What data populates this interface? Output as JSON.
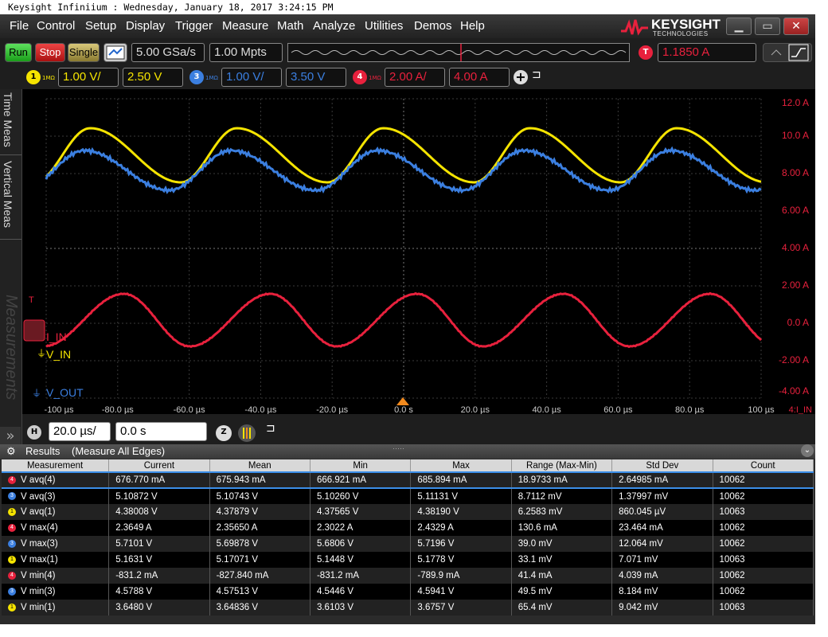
{
  "title_bar": "Keysight Infiniium : Wednesday, January 18, 2017 3:24:15 PM",
  "menu": [
    "File",
    "Control",
    "Setup",
    "Display",
    "Trigger",
    "Measure",
    "Math",
    "Analyze",
    "Utilities",
    "Demos",
    "Help"
  ],
  "logo": {
    "name": "KEYSIGHT",
    "sub": "TECHNOLOGIES"
  },
  "toolbar": {
    "run": "Run",
    "stop": "Stop",
    "single": "Single",
    "sample_rate": "5.00 GSa/s",
    "memory": "1.00 Mpts",
    "trigger_badge": "T",
    "trigger_level": "1.1850 A"
  },
  "channels": [
    {
      "num": "1",
      "imp": "1MΩ",
      "scale": "1.00 V/",
      "offset": "2.50 V",
      "color": "#f5e400"
    },
    {
      "num": "3",
      "imp": "1MΩ",
      "scale": "1.00 V/",
      "offset": "3.50 V",
      "color": "#3b7fe0"
    },
    {
      "num": "4",
      "imp": "1MΩ",
      "scale": "2.00 A/",
      "offset": "4.00 A",
      "color": "#e8213d"
    }
  ],
  "side_tabs": [
    "Time Meas",
    "Vertical Meas",
    "Measurements"
  ],
  "scope": {
    "right_axis": [
      "12.0 A",
      "10.0 A",
      "8.00 A",
      "6.00 A",
      "4.00 A",
      "2.00 A",
      "0.0 A",
      "-2.00 A",
      "-4.00 A"
    ],
    "time_axis": [
      "-100 µs",
      "-80.0 µs",
      "-60.0 µs",
      "-40.0 µs",
      "-20.0 µs",
      "0.0 s",
      "20.0 µs",
      "40.0 µs",
      "60.0 µs",
      "80.0 µs",
      "100 µs"
    ],
    "axis_marker": "4:I_IN",
    "labels": {
      "i_in": "I_IN",
      "v_in": "V_IN",
      "v_out": "V_OUT",
      "trigger": "T"
    }
  },
  "horizontal": {
    "badge": "H",
    "scale": "20.0 µs/",
    "position": "0.0 s"
  },
  "results": {
    "title": "Results",
    "mode": "(Measure All Edges)",
    "columns": [
      "Measurement",
      "Current",
      "Mean",
      "Min",
      "Max",
      "Range (Max-Min)",
      "Std Dev",
      "Count"
    ],
    "rows": [
      {
        "ch": "4",
        "color": "#e8213d",
        "cells": [
          "V avq(4)",
          "676.770 mA",
          "675.943 mA",
          "666.921 mA",
          "685.894 mA",
          "18.9733 mA",
          "2.64985 mA",
          "10062"
        ]
      },
      {
        "ch": "3",
        "color": "#3b7fe0",
        "cells": [
          "V avq(3)",
          "5.10872 V",
          "5.10743 V",
          "5.10260 V",
          "5.11131 V",
          "8.7112 mV",
          "1.37997 mV",
          "10062"
        ]
      },
      {
        "ch": "1",
        "color": "#f5e400",
        "cells": [
          "V avq(1)",
          "4.38008 V",
          "4.37879 V",
          "4.37565 V",
          "4.38190 V",
          "6.2583 mV",
          "860.045 µV",
          "10063"
        ]
      },
      {
        "ch": "4",
        "color": "#e8213d",
        "cells": [
          "V max(4)",
          "2.3649 A",
          "2.35650 A",
          "2.3022 A",
          "2.4329 A",
          "130.6 mA",
          "23.464 mA",
          "10062"
        ]
      },
      {
        "ch": "3",
        "color": "#3b7fe0",
        "cells": [
          "V max(3)",
          "5.7101 V",
          "5.69878 V",
          "5.6806 V",
          "5.7196 V",
          "39.0 mV",
          "12.064 mV",
          "10062"
        ]
      },
      {
        "ch": "1",
        "color": "#f5e400",
        "cells": [
          "V max(1)",
          "5.1631 V",
          "5.17071 V",
          "5.1448 V",
          "5.1778 V",
          "33.1 mV",
          "7.071 mV",
          "10063"
        ]
      },
      {
        "ch": "4",
        "color": "#e8213d",
        "cells": [
          "V min(4)",
          "-831.2 mA",
          "-827.840 mA",
          "-831.2 mA",
          "-789.9 mA",
          "41.4 mA",
          "4.039 mA",
          "10062"
        ]
      },
      {
        "ch": "3",
        "color": "#3b7fe0",
        "cells": [
          "V min(3)",
          "4.5788 V",
          "4.57513 V",
          "4.5446 V",
          "4.5941 V",
          "49.5 mV",
          "8.184 mV",
          "10062"
        ]
      },
      {
        "ch": "1",
        "color": "#f5e400",
        "cells": [
          "V min(1)",
          "3.6480 V",
          "3.64836 V",
          "3.6103 V",
          "3.6757 V",
          "65.4 mV",
          "9.042 mV",
          "10063"
        ]
      }
    ]
  }
}
